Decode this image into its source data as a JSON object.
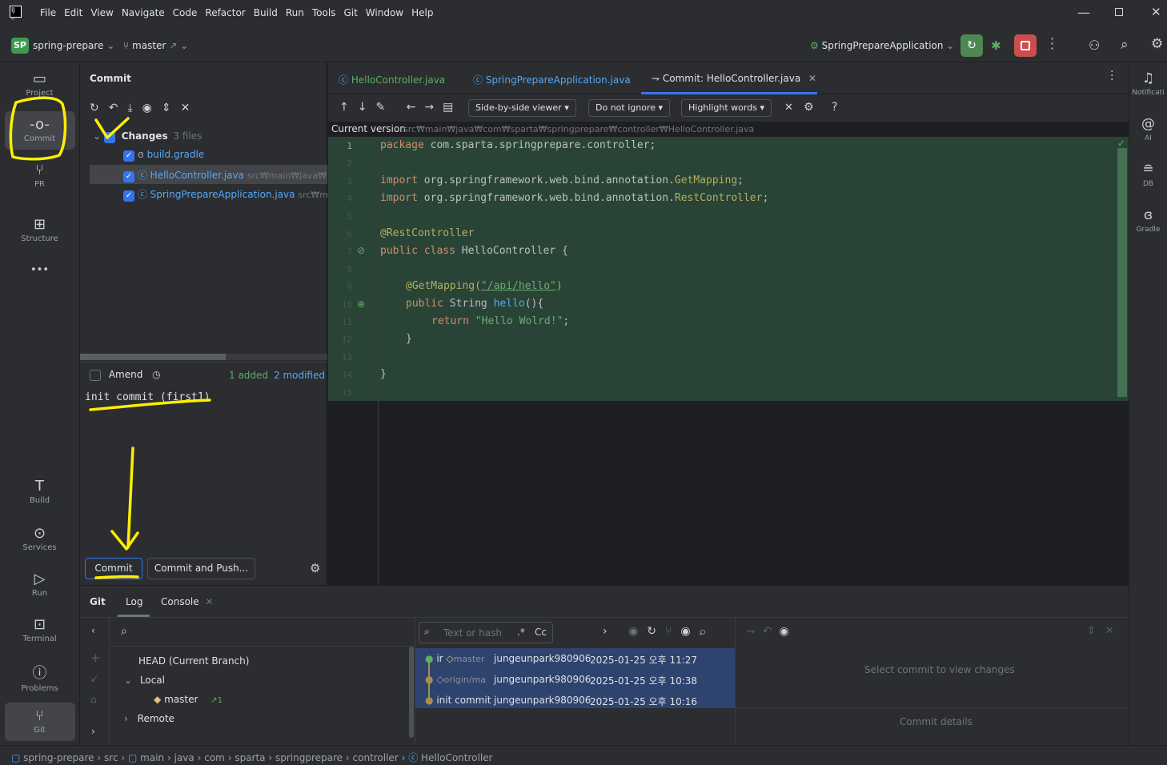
{
  "menu": [
    "File",
    "Edit",
    "View",
    "Navigate",
    "Code",
    "Refactor",
    "Build",
    "Run",
    "Tools",
    "Git",
    "Window",
    "Help"
  ],
  "project": {
    "badge": "SP",
    "name": "spring-prepare",
    "branch": "master"
  },
  "run_config": "SpringPrepareApplication",
  "left_tools": {
    "project": "Project",
    "commit": "Commit",
    "pr": "PR",
    "structure": "Structure",
    "more": "•••",
    "build": "Build",
    "services": "Services",
    "run": "Run",
    "terminal": "Terminal",
    "problems": "Problems",
    "git": "Git"
  },
  "right_tools": {
    "notifications": "Notificati",
    "ai": "AI",
    "db": "DB",
    "gradle": "Gradle"
  },
  "commit_panel": {
    "title": "Commit",
    "changes_label": "Changes",
    "changes_count": "3 files",
    "files": [
      {
        "name": "build.gradle",
        "path": ""
      },
      {
        "name": "HelloController.java",
        "path": "src₩main₩java₩co"
      },
      {
        "name": "SpringPrepareApplication.java",
        "path": "src₩mair"
      }
    ],
    "amend": "Amend",
    "added": "1 added",
    "modified": "2 modified",
    "message": "init commit (first1)",
    "commit_btn": "Commit",
    "commit_push_btn": "Commit and Push..."
  },
  "tabs": [
    "HelloController.java",
    "SpringPrepareApplication.java",
    "Commit: HelloController.java"
  ],
  "diff_toolbar": {
    "viewer": "Side-by-side viewer",
    "ignore": "Do not ignore",
    "highlight": "Highlight words",
    "help": "?"
  },
  "current_version": {
    "label": "Current version",
    "path": "src₩main₩java₩com₩sparta₩springprepare₩controller₩HelloController.java"
  },
  "line_numbers": [
    "1",
    "2",
    "3",
    "4",
    "5",
    "6",
    "7",
    "8",
    "9",
    "10",
    "11",
    "12",
    "13",
    "14",
    "15"
  ],
  "code": {
    "l1a": "package",
    " l1b": " com.sparta.springprepare.controller;",
    "import": "import",
    "l3": " org.springframework.web.bind.annotation.",
    "l3c": "GetMapping",
    "l4c": "RestController",
    "l6": "@RestController",
    "public": "public",
    "class": " class",
    " l7": " HelloController {",
    "l9a": "@GetMapping(",
    "l9b": "\"/api/hello\"",
    "l9c": ")",
    "l10a": " String ",
    "l10b": "hello",
    "l10c": "(){",
    "return": "return",
    "l11b": " \"Hello Wolrd!\"",
    ";": ";",
    "brace": "}"
  },
  "bottom": {
    "tabs": [
      "Git",
      "Log",
      "Console"
    ],
    "head": "HEAD (Current Branch)",
    "local": "Local",
    "master": "master",
    "master_ahead": "↗1",
    "remote": "Remote",
    "search_placeholder": "Text or hash",
    "regex": ".*",
    "case": "Cc",
    "commits": [
      {
        "msg": "ir",
        "tag": "master",
        "author": "jungeunpark980906",
        "date": "2025-01-25 오후 11:27"
      },
      {
        "msg": "",
        "tag": "origin/ma",
        "author": "jungeunpark980906",
        "date": "2025-01-25 오후 10:38"
      },
      {
        "msg": "init commit (",
        "tag": "",
        "author": "jungeunpark980906",
        "date": "2025-01-25 오후 10:16"
      }
    ],
    "select_commit": "Select commit to view changes",
    "commit_details": "Commit details"
  },
  "statusbar": [
    "spring-prepare",
    "src",
    "main",
    "java",
    "com",
    "sparta",
    "springprepare",
    "controller",
    "HelloController"
  ]
}
